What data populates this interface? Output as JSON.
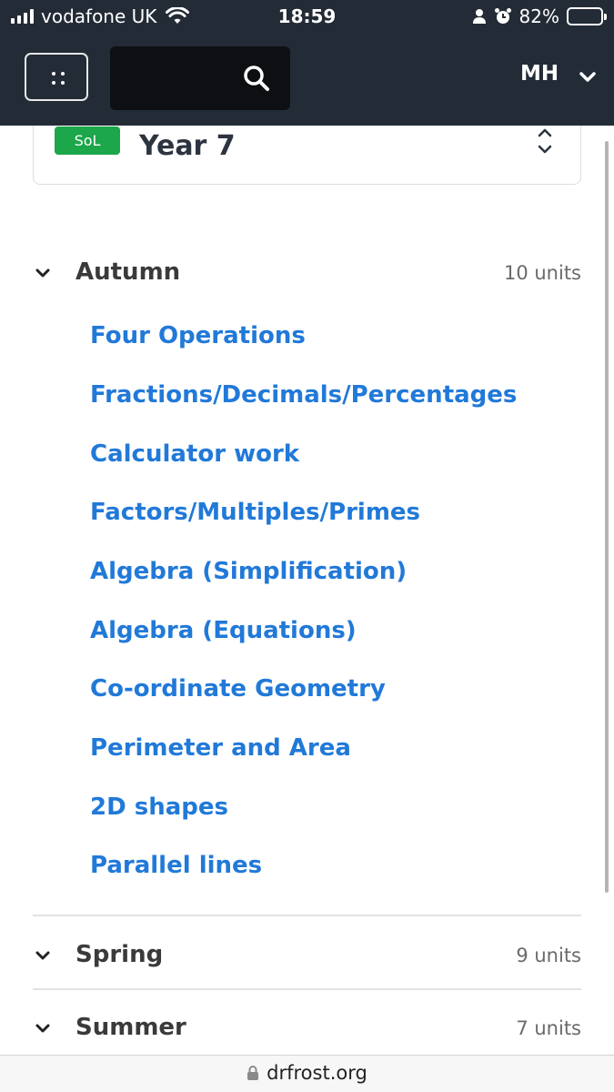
{
  "status_bar": {
    "carrier": "vodafone UK",
    "time": "18:59",
    "battery": "82%",
    "battery_level": 0.82,
    "icons": [
      "signal-icon",
      "wifi-icon",
      "person-icon",
      "alarm-icon",
      "battery-icon"
    ]
  },
  "header": {
    "menu_icon": "grid-menu-icon",
    "search_icon": "search-icon",
    "user_initials": "MH",
    "user_menu_icon": "chevron-down-icon"
  },
  "year_selector": {
    "badge": "SoL",
    "title": "Year 7",
    "badge_color": "#1ba74a"
  },
  "sections": [
    {
      "name": "Autumn",
      "count": "10 units",
      "expanded": true,
      "units": [
        "Four Operations",
        "Fractions/Decimals/Percentages",
        "Calculator work",
        "Factors/Multiples/Primes",
        "Algebra (Simplification)",
        "Algebra (Equations)",
        "Co-ordinate Geometry",
        "Perimeter and Area",
        "2D shapes",
        "Parallel lines"
      ]
    },
    {
      "name": "Spring",
      "count": "9 units",
      "expanded": false
    },
    {
      "name": "Summer",
      "count": "7 units",
      "expanded": false
    }
  ],
  "browser": {
    "url": "drfrost.org"
  },
  "colors": {
    "header_bg": "#232b36",
    "link": "#2179d8",
    "badge": "#1ba74a"
  }
}
